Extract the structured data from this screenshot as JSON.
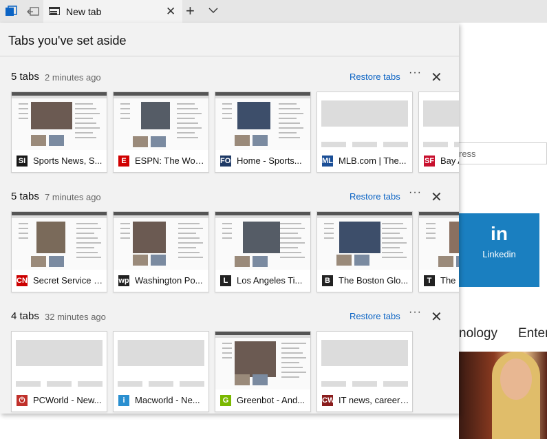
{
  "titlebar": {
    "tab_label": "New tab",
    "icons": [
      "tabs-aside-icon",
      "set-aside-icon",
      "new-tab-page-icon",
      "close-icon",
      "plus-icon",
      "chevron-down-icon"
    ]
  },
  "panel": {
    "title": "Tabs you've set aside"
  },
  "groups": [
    {
      "count": "5 tabs",
      "time": "2 minutes ago",
      "restore": "Restore tabs",
      "more": "···",
      "close": "✕",
      "tabs": [
        {
          "title": "Sports News, S...",
          "fav": "SI",
          "fav_color": "#1a1a1a",
          "thumb": "site"
        },
        {
          "title": "ESPN: The Worl...",
          "fav": "E",
          "fav_color": "#d00000",
          "thumb": "site"
        },
        {
          "title": "Home - Sports...",
          "fav": "FOX",
          "fav_color": "#1f3a66",
          "thumb": "site"
        },
        {
          "title": "MLB.com | The...",
          "fav": "MLB",
          "fav_color": "#1a4e96",
          "thumb": "blank"
        },
        {
          "title": "Bay A",
          "fav": "SF",
          "fav_color": "#c8102e",
          "thumb": "blank"
        }
      ]
    },
    {
      "count": "5 tabs",
      "time": "7 minutes ago",
      "restore": "Restore tabs",
      "more": "···",
      "close": "✕",
      "tabs": [
        {
          "title": "Secret Service a...",
          "fav": "CNN",
          "fav_color": "#cc0000",
          "thumb": "site"
        },
        {
          "title": "Washington Po...",
          "fav": "wp",
          "fav_color": "#222222",
          "thumb": "site"
        },
        {
          "title": "Los Angeles Ti...",
          "fav": "L",
          "fav_color": "#222222",
          "thumb": "site"
        },
        {
          "title": "The Boston Glo...",
          "fav": "B",
          "fav_color": "#222222",
          "thumb": "site"
        },
        {
          "title": "The I",
          "fav": "T",
          "fav_color": "#222222",
          "thumb": "site"
        }
      ]
    },
    {
      "count": "4 tabs",
      "time": "32 minutes ago",
      "restore": "Restore tabs",
      "more": "···",
      "close": "✕",
      "tabs": [
        {
          "title": "PCWorld - New...",
          "fav": "⏻",
          "fav_color": "#c0302a",
          "thumb": "blank"
        },
        {
          "title": "Macworld - Ne...",
          "fav": "i",
          "fav_color": "#2a8fd0",
          "thumb": "blank"
        },
        {
          "title": "Greenbot - And...",
          "fav": "G",
          "fav_color": "#7ab800",
          "thumb": "site"
        },
        {
          "title": "IT news, careers...",
          "fav": "CW",
          "fav_color": "#8a1c1c",
          "thumb": "blank"
        }
      ]
    }
  ],
  "background": {
    "search_text": "ress",
    "linkedin_logo": "in",
    "linkedin_label": "Linkedin",
    "nav_items": [
      "nology",
      "Enter"
    ]
  }
}
